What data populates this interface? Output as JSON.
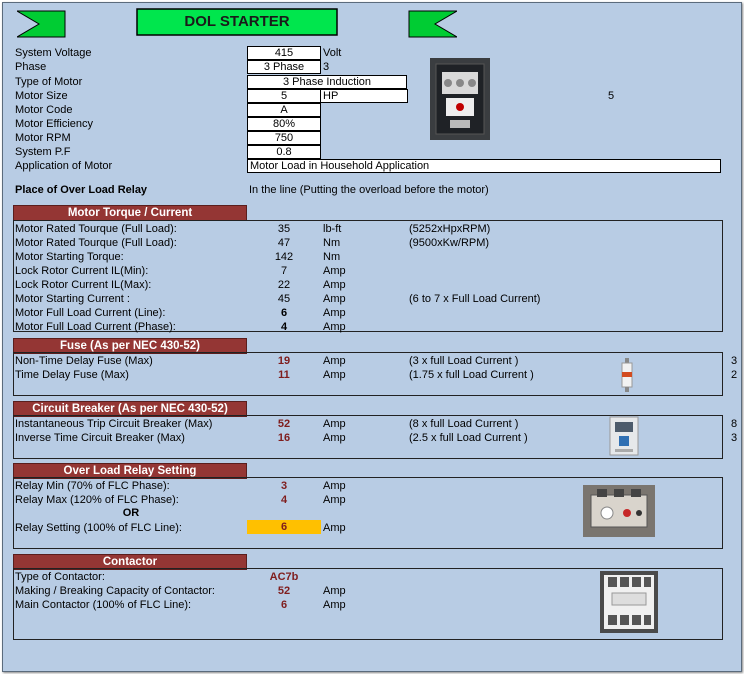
{
  "title": "DOL STARTER",
  "inputs": {
    "system_voltage": {
      "label": "System Voltage",
      "value": "415",
      "unit": "Volt"
    },
    "phase": {
      "label": "Phase",
      "value": "3 Phase",
      "unit": "3"
    },
    "motor_type": {
      "label": "Type of Motor",
      "value": "3 Phase Induction"
    },
    "motor_size": {
      "label": "Motor Size",
      "value": "5",
      "unit": "HP",
      "extra": "5"
    },
    "motor_code": {
      "label": "Motor Code",
      "value": "A"
    },
    "motor_efficiency": {
      "label": "Motor Efficiency",
      "value": "80%"
    },
    "motor_rpm": {
      "label": "Motor RPM",
      "value": "750"
    },
    "system_pf": {
      "label": "System P.F",
      "value": "0.8"
    },
    "application": {
      "label": "Application of Motor",
      "value": "Motor Load in Household Application"
    }
  },
  "overload_place": {
    "label": "Place of Over Load Relay",
    "value": "In the line (Putting the overload before the motor)"
  },
  "torque": {
    "header": "Motor Torque /  Current",
    "rows": [
      {
        "label": "Motor Rated Tourque (Full Load):",
        "value": "35",
        "unit": "lb-ft",
        "note": "(5252xHpxRPM)"
      },
      {
        "label": "Motor Rated Tourque (Full Load):",
        "value": "47",
        "unit": "Nm",
        "note": "(9500xKw/RPM)"
      },
      {
        "label": "Motor Starting Torque:",
        "value": "142",
        "unit": "Nm",
        "note": ""
      },
      {
        "label": "Lock Rotor Current IL(Min):",
        "value": "7",
        "unit": "Amp",
        "note": ""
      },
      {
        "label": "Lock Rotor Current IL(Max):",
        "value": "22",
        "unit": "Amp",
        "note": ""
      },
      {
        "label": "Motor Starting Current :",
        "value": "45",
        "unit": "Amp",
        "note": "(6 to 7 x Full Load Current)"
      },
      {
        "label": "Motor Full Load Current (Line):",
        "value": "6",
        "unit": "Amp",
        "note": ""
      },
      {
        "label": "Motor Full Load Current (Phase):",
        "value": "4",
        "unit": "Amp",
        "note": ""
      }
    ]
  },
  "fuse": {
    "header": "Fuse (As per NEC 430-52)",
    "rows": [
      {
        "label": "Non-Time Delay Fuse (Max)",
        "value": "19",
        "unit": "Amp",
        "note": "(3 x full Load Current )",
        "edge": "3"
      },
      {
        "label": "Time Delay Fuse (Max)",
        "value": "11",
        "unit": "Amp",
        "note": "(1.75 x full Load Current )",
        "edge": "2"
      }
    ]
  },
  "breaker": {
    "header": "Circuit Breaker (As per NEC 430-52)",
    "rows": [
      {
        "label": "Instantaneous Trip Circuit Breaker (Max)",
        "value": "52",
        "unit": "Amp",
        "note": "(8 x full Load Current )",
        "edge": "8"
      },
      {
        "label": "Inverse Time Circuit Breaker (Max)",
        "value": "16",
        "unit": "Amp",
        "note": "(2.5 x full Load Current )",
        "edge": "3"
      }
    ]
  },
  "relay": {
    "header": "Over Load Relay  Setting",
    "min": {
      "label": "Relay Min (70% of FLC Phase):",
      "value": "3",
      "unit": "Amp"
    },
    "max": {
      "label": "Relay Max (120% of FLC Phase):",
      "value": "4",
      "unit": "Amp"
    },
    "or": "OR",
    "setting": {
      "label": "Relay Setting (100% of FLC Line):",
      "value": "6",
      "unit": "Amp"
    }
  },
  "contactor": {
    "header": "Contactor",
    "type": {
      "label": "Type of Contactor:",
      "value": "AC7b"
    },
    "capacity": {
      "label": "Making / Breaking Capacity of Contactor:",
      "value": "52",
      "unit": "Amp"
    },
    "main": {
      "label": "Main Contactor (100% of FLC Line):",
      "value": "6",
      "unit": "Amp"
    }
  }
}
